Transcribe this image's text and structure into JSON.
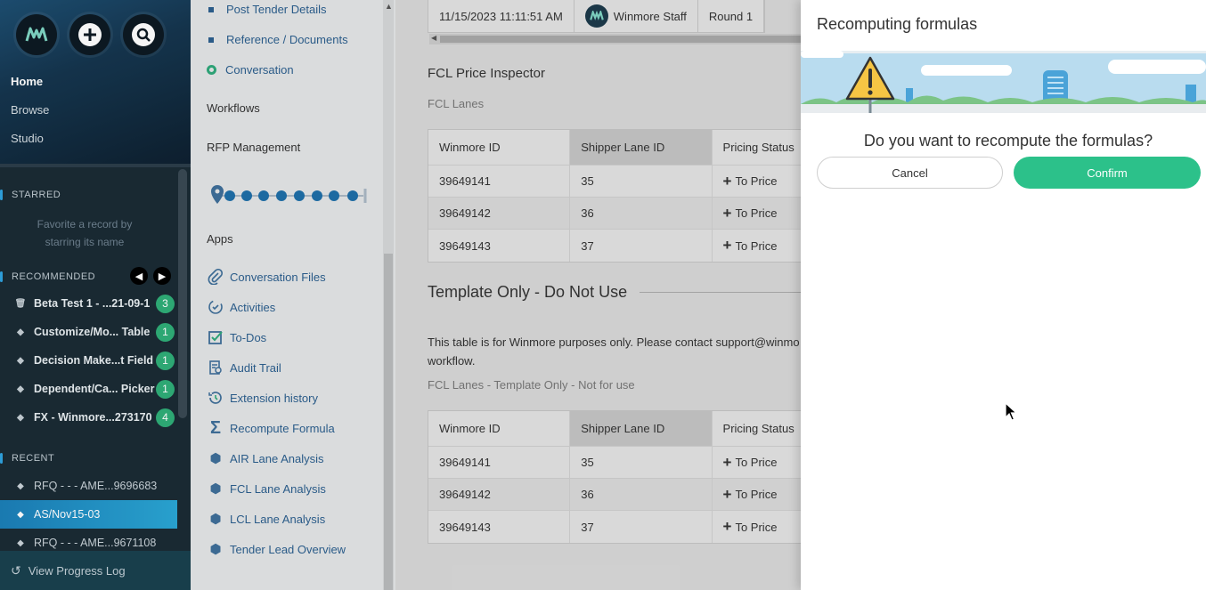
{
  "sidebar": {
    "nav": [
      "Home",
      "Browse",
      "Studio"
    ],
    "starred_title": "STARRED",
    "starred_empty": "Favorite a record by starring its name",
    "recommended_title": "RECOMMENDED",
    "recommended": [
      {
        "icon": "trash-icon",
        "label": "Beta Test 1 - ...21-09-1",
        "count": "3"
      },
      {
        "icon": "diamond-icon",
        "label": "Customize/Mo... Table",
        "count": "1"
      },
      {
        "icon": "diamond-icon",
        "label": "Decision Make...t Field",
        "count": "1"
      },
      {
        "icon": "diamond-icon",
        "label": "Dependent/Ca... Picker",
        "count": "1"
      },
      {
        "icon": "diamond-icon",
        "label": "FX - Winmore...273170",
        "count": "4"
      }
    ],
    "recent_title": "RECENT",
    "recent": [
      {
        "label": "RFQ - - - AME...9696683"
      },
      {
        "label": "AS/Nov15-03"
      },
      {
        "label": "RFQ - - - AME...9671108"
      }
    ],
    "footer": "View Progress Log"
  },
  "col2": {
    "links": [
      "Post Tender Details",
      "Reference / Documents"
    ],
    "conversation": "Conversation",
    "workflows": "Workflows",
    "rfp": "RFP Management",
    "apps_title": "Apps",
    "apps": [
      {
        "icon": "paperclip-icon",
        "label": "Conversation Files"
      },
      {
        "icon": "activities-icon",
        "label": "Activities"
      },
      {
        "icon": "checkbox-icon",
        "label": "To-Dos"
      },
      {
        "icon": "audit-icon",
        "label": "Audit Trail"
      },
      {
        "icon": "history-icon",
        "label": "Extension history"
      },
      {
        "icon": "sigma-icon",
        "label": "Recompute Formula"
      },
      {
        "icon": "hexagon-icon",
        "label": "AIR Lane Analysis"
      },
      {
        "icon": "hexagon-icon",
        "label": "FCL Lane Analysis"
      },
      {
        "icon": "hexagon-icon",
        "label": "LCL Lane Analysis"
      },
      {
        "icon": "hexagon-icon",
        "label": "Tender Lead Overview"
      }
    ]
  },
  "main": {
    "top_row": {
      "timestamp": "11/15/2023 11:11:51 AM",
      "staff": "Winmore Staff",
      "round": "Round 1"
    },
    "inspector_title": "FCL Price Inspector",
    "lanes_label": "FCL Lanes",
    "table_headers": [
      "Winmore ID",
      "Shipper Lane ID",
      "Pricing Status"
    ],
    "table1": [
      {
        "id": "39649141",
        "lane": "35",
        "status": "To Price"
      },
      {
        "id": "39649142",
        "lane": "36",
        "status": "To Price"
      },
      {
        "id": "39649143",
        "lane": "37",
        "status": "To Price"
      }
    ],
    "template_title": "Template Only - Do Not Use",
    "description_line1": "This table is for Winmore purposes only. Please contact support@winmo",
    "description_line2": "workflow.",
    "template_lanes_label": "FCL Lanes - Template Only - Not for use",
    "table2": [
      {
        "id": "39649141",
        "lane": "35",
        "status": "To Price"
      },
      {
        "id": "39649142",
        "lane": "36",
        "status": "To Price"
      },
      {
        "id": "39649143",
        "lane": "37",
        "status": "To Price"
      }
    ]
  },
  "panel": {
    "title": "Recomputing formulas",
    "question": "Do you want to recompute the formulas?",
    "cancel": "Cancel",
    "confirm": "Confirm",
    "confirm_color": "#2cc18a"
  }
}
